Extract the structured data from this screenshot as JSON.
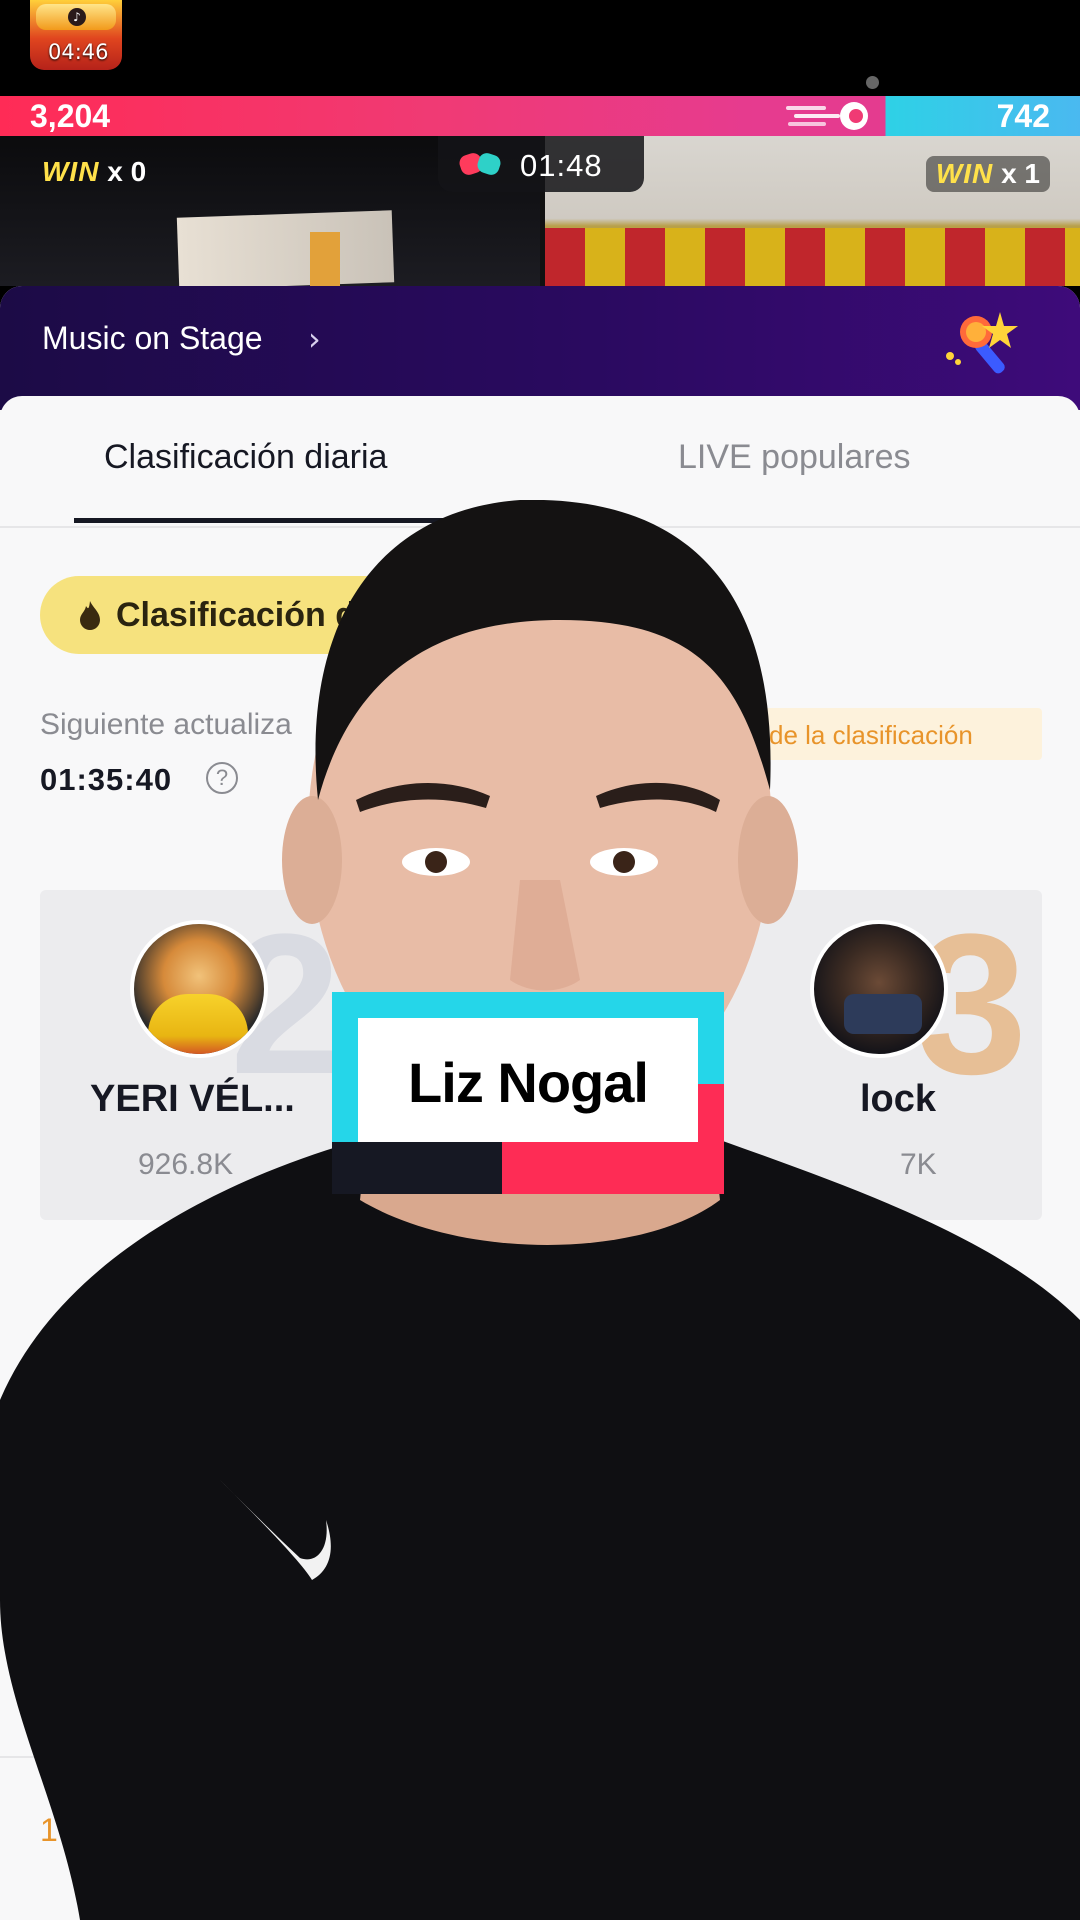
{
  "top": {
    "chest_timer": "04:46"
  },
  "battle": {
    "score_left": "3,204",
    "score_right": "742",
    "timer": "01:48",
    "win_word": "WIN",
    "win_left_count": "x 0",
    "win_right_count": "x 1"
  },
  "stage": {
    "title": "Music on Stage",
    "chevron": "›"
  },
  "tabs": {
    "daily": "Clasificación diaria",
    "popular": "LIVE populares",
    "active": "daily"
  },
  "ranking": {
    "pill_label": "Clasificación di",
    "next_update_label": "Siguiente actualiza",
    "countdown": "01:35:40",
    "help_glyph": "?",
    "rules_link": "l de la clasificación"
  },
  "podium": {
    "second": {
      "rank": "2",
      "name": "YERI VÉL...",
      "score": "926.8K"
    },
    "third": {
      "rank": "3",
      "name": "lock",
      "score": "7K"
    }
  },
  "list": {
    "first_rank": "1"
  },
  "overlay": {
    "name_card": "Liz Nogal"
  },
  "colors": {
    "accent_pink": "#fe2c55",
    "accent_cyan": "#25d6e9",
    "stage_purple": "#2a0a60",
    "pill_yellow": "#f6e27e"
  },
  "icons": [
    "treasure-chest-icon",
    "comet-icon",
    "boxing-gloves-icon",
    "microphone-star-icon",
    "flame-icon",
    "help-icon",
    "chevron-right-icon"
  ]
}
